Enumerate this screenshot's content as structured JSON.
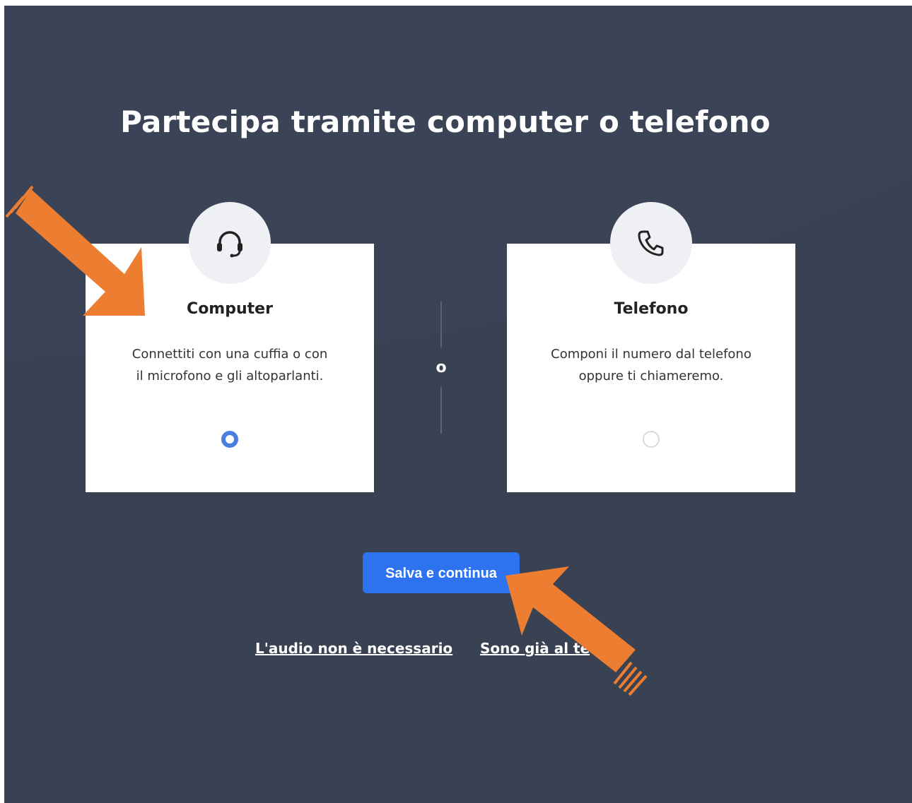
{
  "title": "Partecipa tramite computer o telefono",
  "options": [
    {
      "label": "Computer",
      "description": "Connettiti con una cuffia o con il microfono e gli altoparlanti.",
      "icon": "headset-icon",
      "selected": true
    },
    {
      "label": "Telefono",
      "description": "Componi il numero dal telefono oppure ti chiameremo.",
      "icon": "phone-icon",
      "selected": false
    }
  ],
  "divider_text": "o",
  "save_button": "Salva e continua",
  "links": {
    "no_audio": "L'audio non è necessario",
    "already_phone": "Sono già al te"
  },
  "colors": {
    "background": "#3b4456",
    "button": "#2d72ee",
    "radio_selected": "#4a7fe0",
    "annotation_arrow": "#ed7d31"
  }
}
